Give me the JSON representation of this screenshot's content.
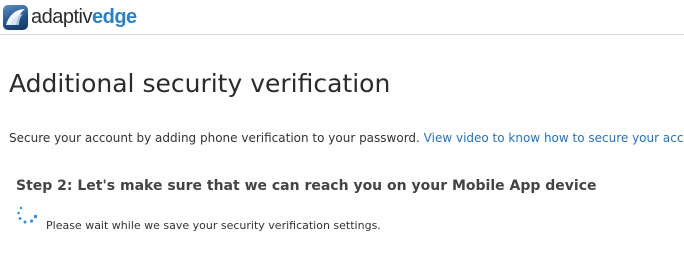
{
  "header": {
    "logo_text_part1": "adaptiv",
    "logo_text_part2": "edge",
    "logo_icon": "adaptivedge-logo-icon",
    "brand_color": "#2f7fc4"
  },
  "main": {
    "title": "Additional security verification",
    "intro_text": "Secure your account by adding phone verification to your password. ",
    "intro_link": "View video to know how to secure your account",
    "link_color": "#2672b9",
    "step_title": "Step 2: Let's make sure that we can reach you on your Mobile App device",
    "spinner_icon": "loading-spinner-icon",
    "wait_message": "Please wait while we save your security verification settings."
  }
}
